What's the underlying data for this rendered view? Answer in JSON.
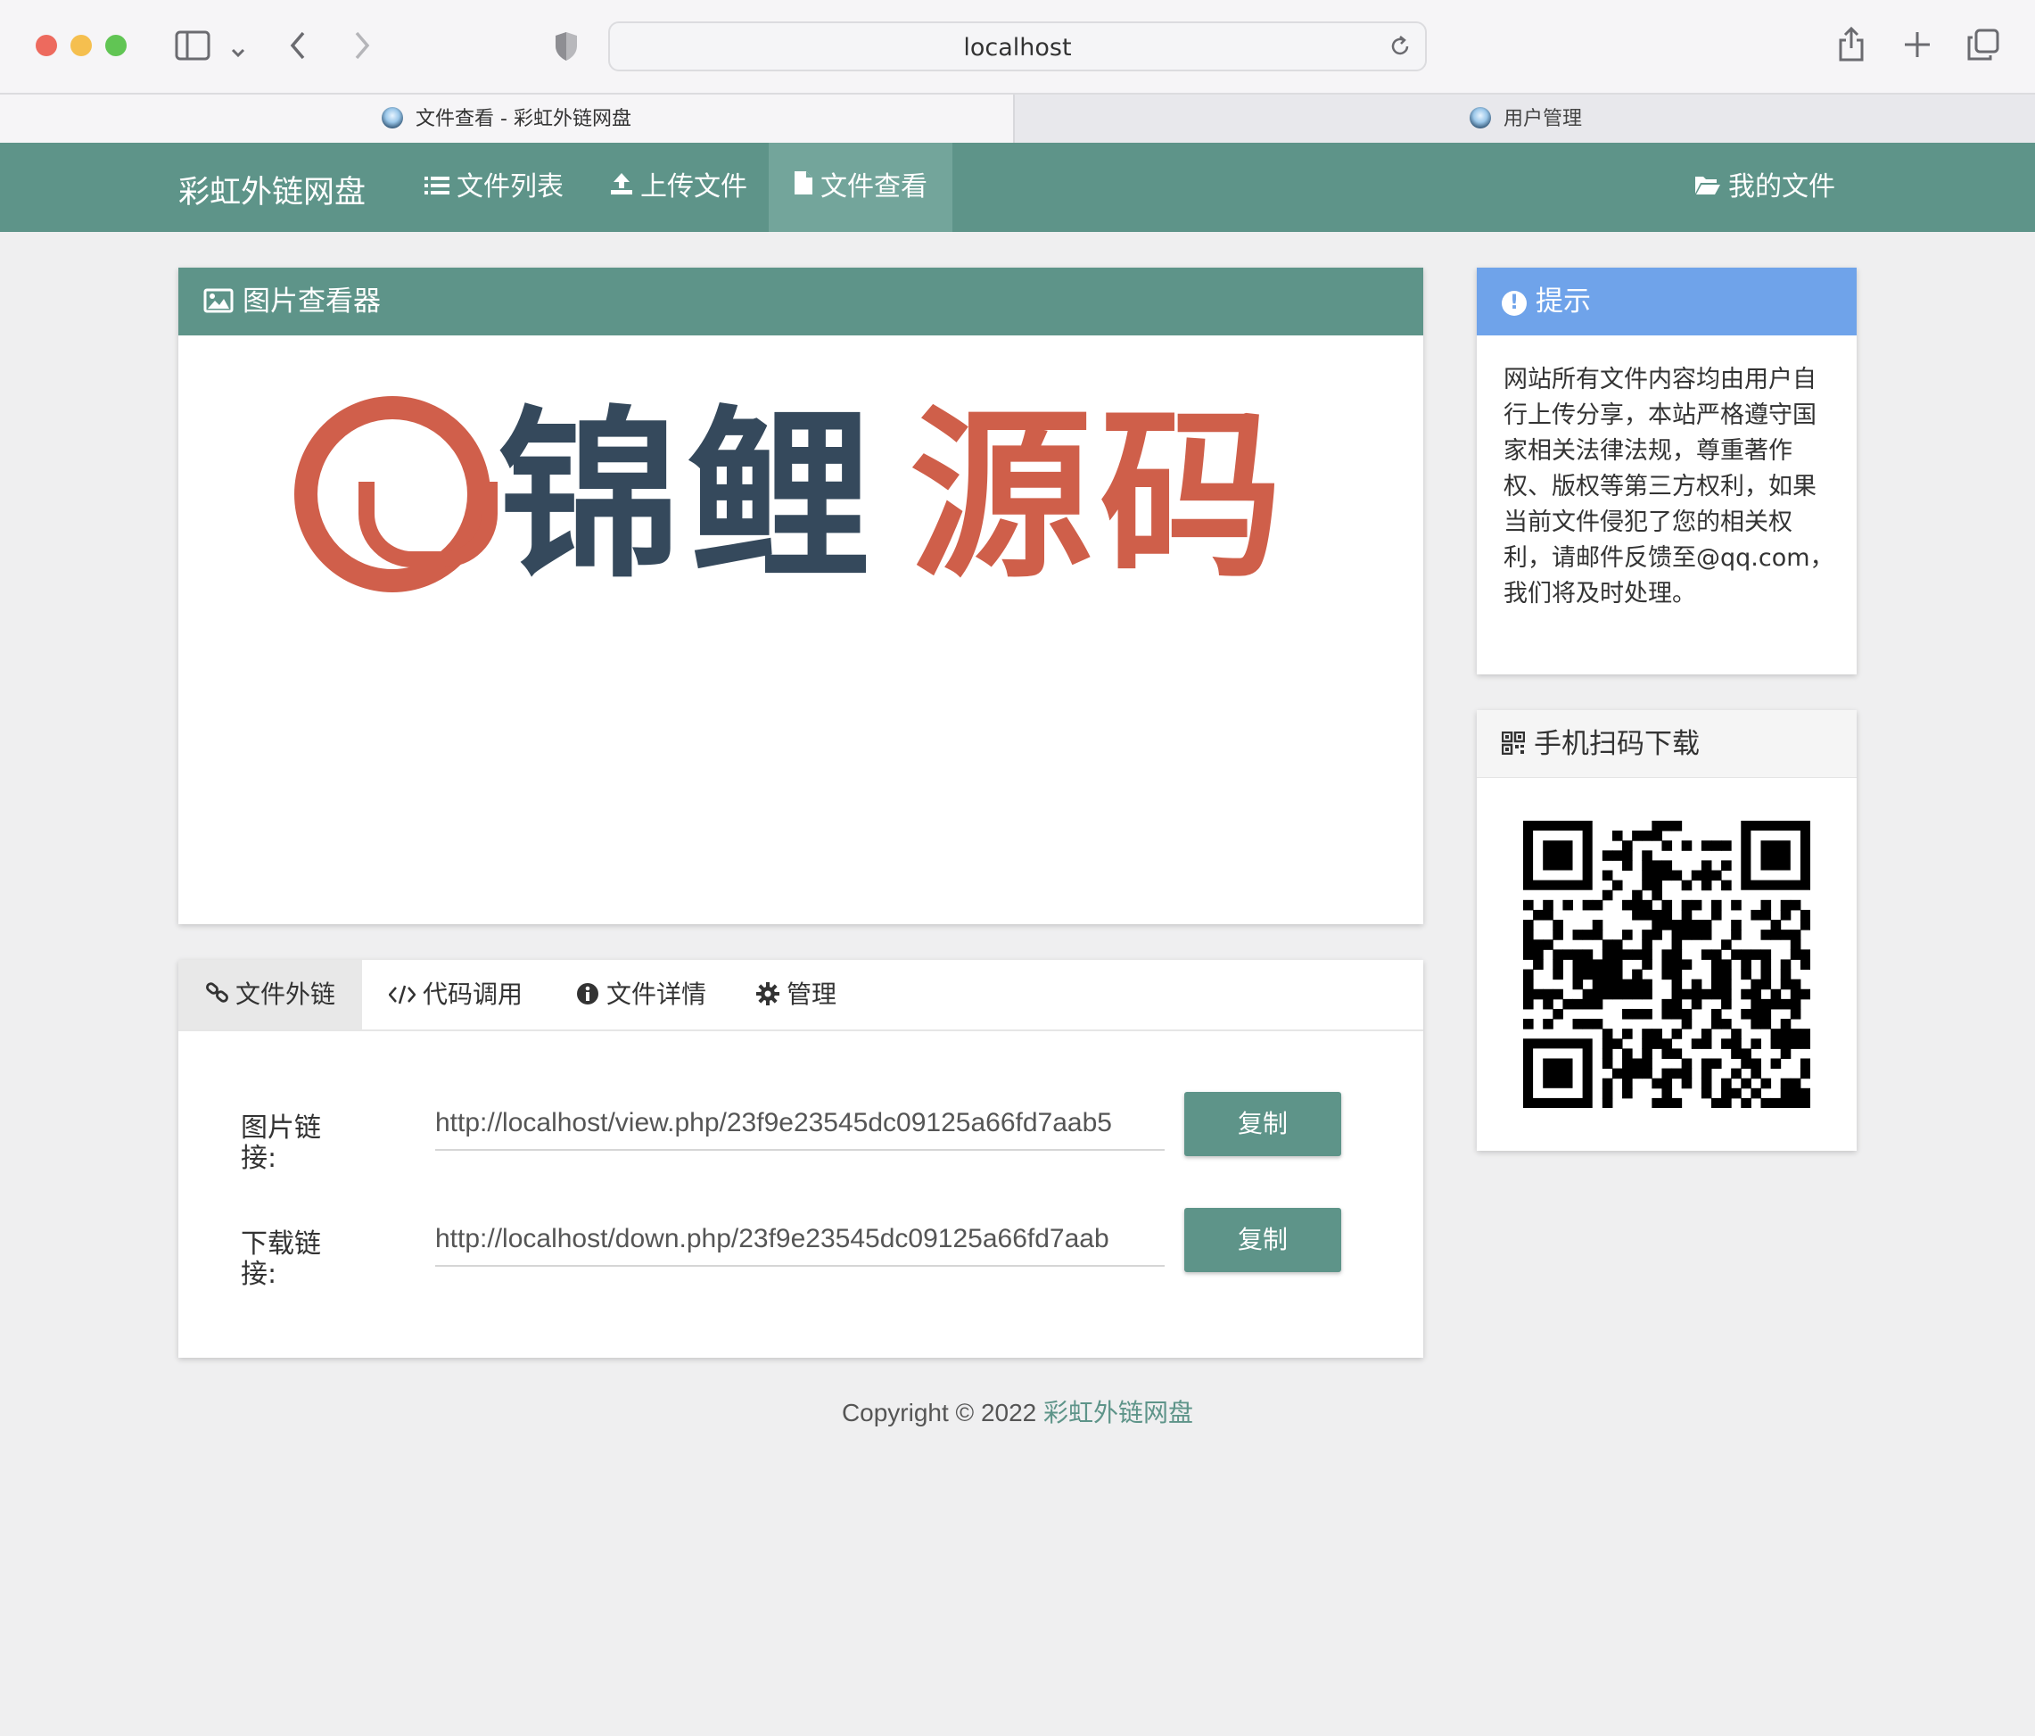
{
  "browser": {
    "url": "localhost",
    "tabs": [
      {
        "label": "文件查看 - 彩虹外链网盘",
        "active": true
      },
      {
        "label": "用户管理",
        "active": false
      }
    ]
  },
  "navbar": {
    "brand": "彩虹外链网盘",
    "items": [
      {
        "label": "文件列表",
        "icon": "list-icon"
      },
      {
        "label": "上传文件",
        "icon": "upload-icon"
      },
      {
        "label": "文件查看",
        "icon": "file-icon",
        "active": true
      },
      {
        "label": "我的文件",
        "icon": "folder-open-icon"
      }
    ]
  },
  "viewer": {
    "title": "图片查看器",
    "image_text": [
      "锦鲤",
      "源码"
    ]
  },
  "notice": {
    "title": "提示",
    "body": "网站所有文件内容均由用户自行上传分享，本站严格遵守国家相关法律法规，尊重著作权、版权等第三方权利，如果当前文件侵犯了您的相关权利，请邮件反馈至@qq.com，我们将及时处理。"
  },
  "qr": {
    "title": "手机扫码下载"
  },
  "link_tabs": [
    {
      "label": "文件外链",
      "icon": "link-icon",
      "active": true
    },
    {
      "label": "代码调用",
      "icon": "code-icon"
    },
    {
      "label": "文件详情",
      "icon": "info-icon"
    },
    {
      "label": "管理",
      "icon": "gear-icon"
    }
  ],
  "link_rows": [
    {
      "label": "图片链接:",
      "value": "http://localhost/view.php/23f9e23545dc09125a66fd7aab5",
      "button": "复制"
    },
    {
      "label": "下载链接:",
      "value": "http://localhost/down.php/23f9e23545dc09125a66fd7aab",
      "button": "复制"
    }
  ],
  "footer": {
    "copyright": "Copyright © 2022 ",
    "site": "彩虹外链网盘"
  },
  "colors": {
    "primary": "#5e9489",
    "notice": "#6fa3ea",
    "logo_red": "#cf5f4a",
    "logo_dark": "#35495c"
  }
}
